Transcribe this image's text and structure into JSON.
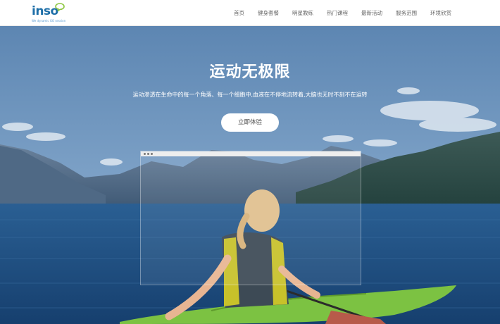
{
  "logo": {
    "text": "inso",
    "tagline": "We dynamic GO session",
    "brand_color": "#1e6fa8",
    "bubble_color": "#8cc63f"
  },
  "nav": {
    "items": [
      {
        "label": "首页"
      },
      {
        "label": "健身套餐"
      },
      {
        "label": "明星教练"
      },
      {
        "label": "热门课程"
      },
      {
        "label": "最新活动"
      },
      {
        "label": "服务范围"
      },
      {
        "label": "环境欣赏"
      }
    ]
  },
  "hero": {
    "title": "运动无极限",
    "subtitle": "运动渗透在生命中的每一个角落、每一个细胞中,血液在不停地流转着,大脑也无时不刻不在运转",
    "cta_label": "立即体验",
    "sky_color": "#5a86b4",
    "water_color": "#1d4f86",
    "kayak_color": "#7cc242"
  }
}
